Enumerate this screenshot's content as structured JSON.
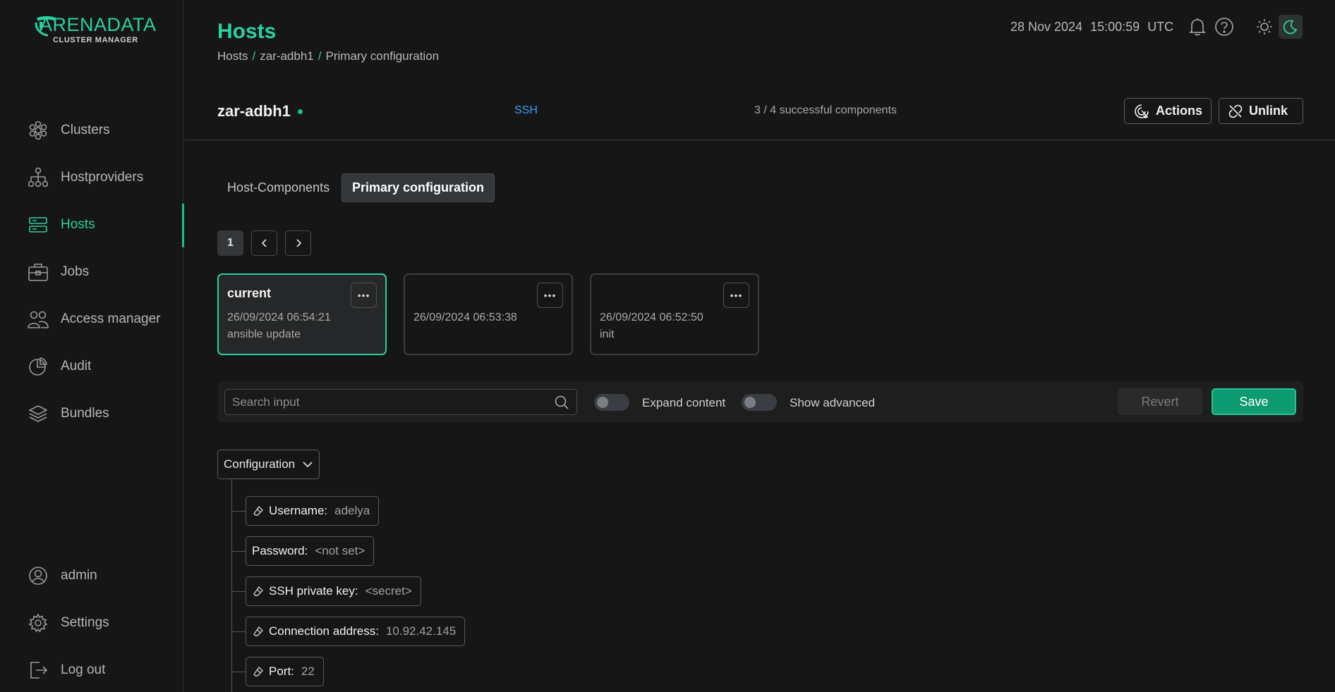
{
  "app": {
    "logo_text": "ARENADATA",
    "logo_sub": "CLUSTER MANAGER"
  },
  "sidebar": {
    "items": [
      {
        "label": "Clusters",
        "icon": "clusters-icon"
      },
      {
        "label": "Hostproviders",
        "icon": "hostproviders-icon"
      },
      {
        "label": "Hosts",
        "icon": "hosts-icon"
      },
      {
        "label": "Jobs",
        "icon": "jobs-icon"
      },
      {
        "label": "Access manager",
        "icon": "access-manager-icon"
      },
      {
        "label": "Audit",
        "icon": "audit-icon"
      },
      {
        "label": "Bundles",
        "icon": "bundles-icon"
      }
    ],
    "active": "Hosts",
    "bottom": [
      {
        "label": "admin",
        "icon": "user-icon"
      },
      {
        "label": "Settings",
        "icon": "gear-icon"
      },
      {
        "label": "Log out",
        "icon": "logout-icon"
      }
    ]
  },
  "header": {
    "title": "Hosts",
    "breadcrumb": [
      "Hosts",
      "zar-adbh1",
      "Primary configuration"
    ],
    "date": "28 Nov 2024",
    "time": "15:00:59",
    "timezone": "UTC"
  },
  "host": {
    "name": "zar-adbh1",
    "provider": "SSH",
    "components": "3 / 4 successful components",
    "actions_label": "Actions",
    "unlink_label": "Unlink"
  },
  "tabs": [
    {
      "label": "Host-Components",
      "active": false
    },
    {
      "label": "Primary configuration",
      "active": true
    }
  ],
  "pagination": {
    "current": "1"
  },
  "config_versions": [
    {
      "title": "current",
      "date": "26/09/2024 06:54:21",
      "description": "ansible update",
      "selected": true
    },
    {
      "title": "",
      "date": "26/09/2024 06:53:38",
      "description": "",
      "selected": false
    },
    {
      "title": "",
      "date": "26/09/2024 06:52:50",
      "description": "init",
      "selected": false
    }
  ],
  "toolbar": {
    "search_placeholder": "Search input",
    "expand_label": "Expand content",
    "advanced_label": "Show advanced",
    "revert_label": "Revert",
    "save_label": "Save"
  },
  "config_tree": {
    "root_label": "Configuration",
    "fields": [
      {
        "name": "Username:",
        "value": "adelya",
        "editable_icon": true
      },
      {
        "name": "Password:",
        "value": "<not set>",
        "editable_icon": false
      },
      {
        "name": "SSH private key:",
        "value": "<secret>",
        "editable_icon": true
      },
      {
        "name": "Connection address:",
        "value": "10.92.42.145",
        "editable_icon": true
      },
      {
        "name": "Port:",
        "value": "22",
        "editable_icon": true
      }
    ]
  },
  "colors": {
    "accent": "#2bd0a0",
    "background": "#161616",
    "link": "#3d9ef5",
    "save": "#0f9b72"
  }
}
